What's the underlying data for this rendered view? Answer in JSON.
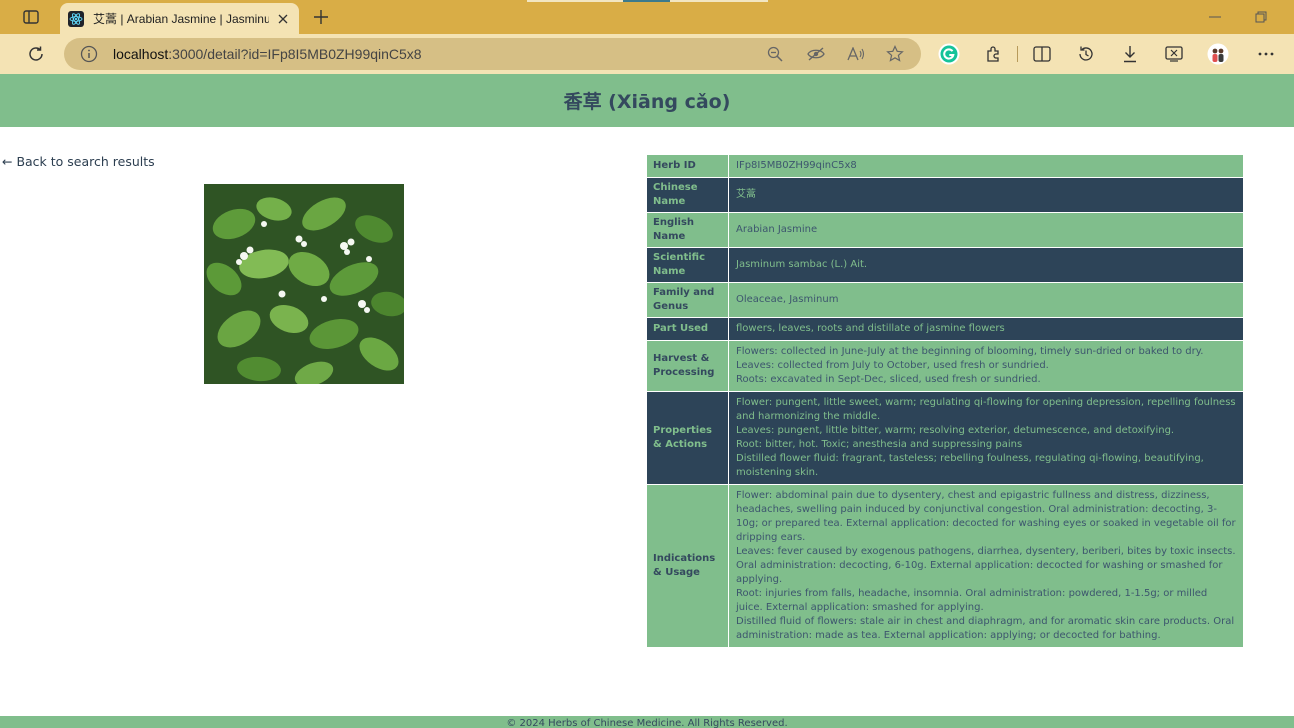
{
  "browser": {
    "tab": {
      "title": "艾蒿 | Arabian Jasmine | Jasminum sambac (L.) Ait.",
      "favicon": "react-logo-icon",
      "close": "close-icon"
    },
    "address_bar": {
      "host": "localhost",
      "path": ":3000/detail?id=IFp8I5MB0ZH99qinC5x8"
    },
    "toolbar_icons": [
      "back-icon",
      "refresh-icon",
      "zoom-out-icon",
      "tracking-prevention-icon",
      "read-aloud-icon",
      "favorite-star-icon",
      "grammarly-icon",
      "extensions-icon",
      "split-screen-icon",
      "history-icon",
      "downloads-icon",
      "screenshot-icon",
      "profile-avatar-icon",
      "more-icon"
    ]
  },
  "header": {
    "title": "香草 (Xiāng cǎo)"
  },
  "back_link": "← Back to search results",
  "image": {
    "alt": "Arabian Jasmine plant photo"
  },
  "details": {
    "rows": [
      {
        "label": "Herb ID",
        "value": [
          "IFp8I5MB0ZH99qinC5x8"
        ]
      },
      {
        "label": "Chinese Name",
        "value": [
          "艾蒿"
        ]
      },
      {
        "label": "English Name",
        "value": [
          "Arabian Jasmine"
        ]
      },
      {
        "label": "Scientific Name",
        "value": [
          "Jasminum sambac (L.) Ait."
        ]
      },
      {
        "label": "Family and Genus",
        "value": [
          "Oleaceae, Jasminum"
        ]
      },
      {
        "label": "Part Used",
        "value": [
          "flowers, leaves, roots and distillate of jasmine flowers"
        ]
      },
      {
        "label": "Harvest & Processing",
        "value": [
          "Flowers: collected in June-July at the beginning of blooming, timely sun-dried or baked to dry.",
          "Leaves: collected from July to October, used fresh or sundried.",
          "Roots: excavated in Sept-Dec, sliced, used fresh or sundried."
        ]
      },
      {
        "label": "Properties & Actions",
        "value": [
          "Flower: pungent, little sweet, warm; regulating qi-flowing for opening depression, repelling foulness and harmonizing the middle.",
          "Leaves: pungent, little bitter, warm; resolving exterior, detumescence, and detoxifying.",
          "Root: bitter, hot. Toxic; anesthesia and suppressing pains",
          "Distilled flower fluid: fragrant, tasteless; rebelling foulness, regulating qi-flowing, beautifying, moistening skin."
        ]
      },
      {
        "label": "Indications & Usage",
        "value": [
          "Flower: abdominal pain due to dysentery, chest and epigastric fullness and distress, dizziness, headaches, swelling pain induced by conjunctival congestion. Oral administration: decocting, 3-10g; or prepared tea. External application: decocted for washing eyes or soaked in vegetable oil for dripping ears.",
          "Leaves: fever caused by exogenous pathogens, diarrhea, dysentery, beriberi, bites by toxic insects. Oral administration: decocting, 6-10g. External application: decocted for washing or smashed for applying.",
          "Root: injuries from falls, headache, insomnia. Oral administration: powdered, 1-1.5g; or milled juice. External application: smashed for applying.",
          "Distilled fluid of flowers: stale air in chest and diaphragm, and for aromatic skin care products. Oral administration: made as tea. External application: applying; or decocted for bathing."
        ]
      }
    ]
  },
  "footer": {
    "text": "© 2024 Herbs of Chinese Medicine. All Rights Reserved."
  },
  "colors": {
    "header_bg": "#80be8c",
    "dark_row": "#2d4458",
    "text_dark": "#34495e",
    "chrome_tabbar": "#d9ad46",
    "chrome_toolbar": "#f4e3b4"
  }
}
